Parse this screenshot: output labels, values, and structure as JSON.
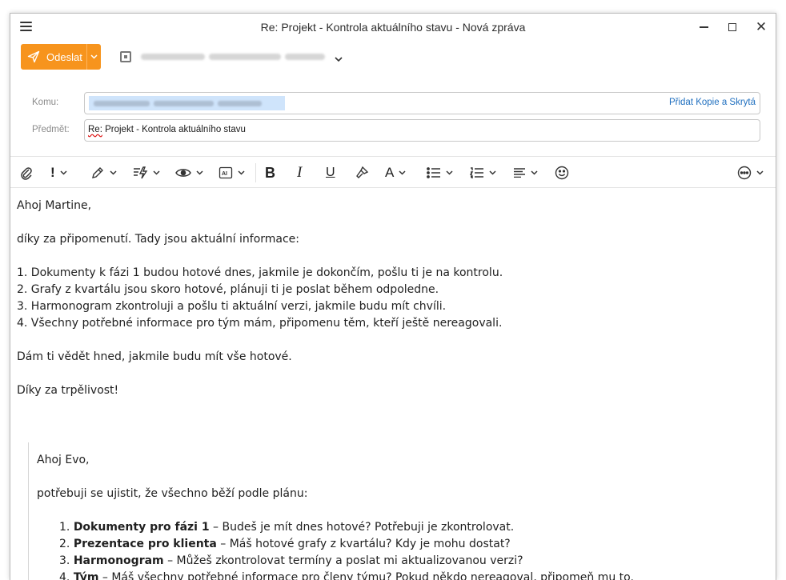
{
  "window": {
    "title": "Re: Projekt - Kontrola aktuálního stavu - Nová zpráva"
  },
  "compose": {
    "send_label": "Odeslat",
    "to_label": "Komu:",
    "cc_bcc_link": "Přidat Kopie a Skrytá",
    "subject_label": "Předmět:",
    "subject_prefix": "Re:",
    "subject_rest": " Projekt - Kontrola aktuálního stavu"
  },
  "toolbar": {
    "items": [
      "paperclip-icon",
      "priority-icon",
      "pen-icon",
      "quick-parts-icon",
      "eye-icon",
      "ai-icon",
      "bold-icon",
      "italic-icon",
      "underline-icon",
      "format-painter-icon",
      "font-color-icon",
      "bullet-list-icon",
      "numbered-list-icon",
      "align-icon",
      "emoji-icon",
      "more-icon"
    ],
    "bold_glyph": "B",
    "italic_glyph": "I",
    "underline_glyph": "U",
    "font_glyph": "A",
    "priority_glyph": "!"
  },
  "message": {
    "greeting": "Ahoj Martine,",
    "intro": "díky za připomenutí. Tady jsou aktuální informace:",
    "points": [
      "1. Dokumenty k fázi 1 budou hotové dnes, jakmile je dokončím, pošlu ti je na kontrolu.",
      "2. Grafy z kvartálu jsou skoro hotové, plánuji ti je poslat během odpoledne.",
      "3. Harmonogram zkontroluji a pošlu ti aktuální verzi, jakmile budu mít chvíli.",
      "4. Všechny potřebné informace pro tým mám, připomenu těm, kteří ještě nereagovali."
    ],
    "closing": "Dám ti vědět hned, jakmile budu mít vše hotové.",
    "thanks": "Díky za trpělivost!"
  },
  "quoted": {
    "greeting": "Ahoj Evo,",
    "intro": "potřebuji se ujistit, že všechno běží podle plánu:",
    "items": [
      {
        "num": "1.",
        "bold": "Dokumenty pro fázi 1",
        "rest": " – Budeš je mít dnes hotové? Potřebuji je zkontrolovat."
      },
      {
        "num": "2.",
        "bold": "Prezentace pro klienta",
        "rest": " – Máš hotové grafy z kvartálu? Kdy je mohu dostat?"
      },
      {
        "num": "3.",
        "bold": "Harmonogram",
        "rest": " – Můžeš zkontrolovat termíny a poslat mi aktualizovanou verzi?"
      },
      {
        "num": "4.",
        "bold": "Tým",
        "rest": " – Máš všechny potřebné informace pro členy týmu? Pokud někdo nereagoval, připomeň mu to."
      }
    ]
  },
  "colors": {
    "accent": "#f7941d",
    "link": "#1f6fbf",
    "recipient_chip": "#cfe4fb"
  }
}
